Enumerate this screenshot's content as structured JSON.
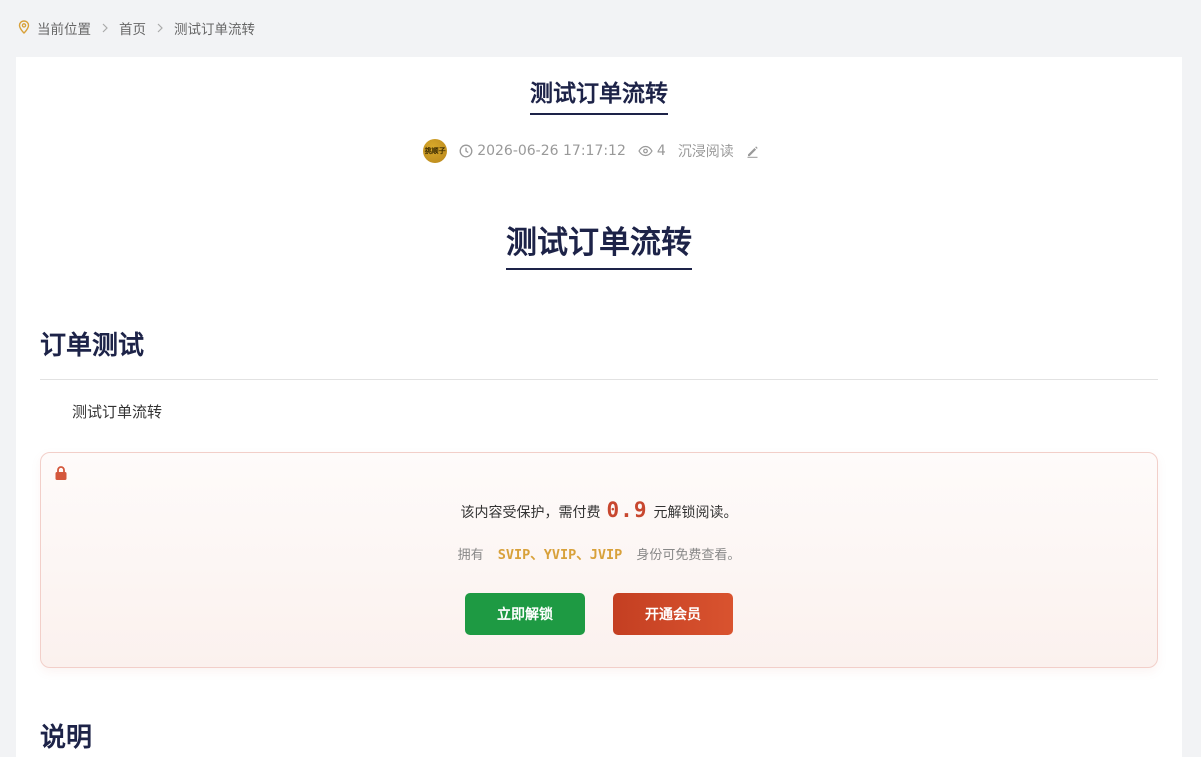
{
  "breadcrumb": {
    "location_label": "当前位置",
    "home": "首页",
    "current": "测试订单流转"
  },
  "post": {
    "title": "测试订单流转",
    "avatar_text": "挑顺子",
    "datetime": "2026-06-26 17:17:12",
    "views": "4",
    "immersive_read": "沉浸阅读"
  },
  "content": {
    "title": "测试订单流转",
    "section1_heading": "订单测试",
    "paragraph": "测试订单流转",
    "section2_heading": "说明"
  },
  "paywall": {
    "msg_prefix": "该内容受保护，需付费",
    "price": "0.9",
    "msg_suffix": "元解锁阅读。",
    "vip_prefix": "拥有",
    "vip_levels": "SVIP、YVIP、JVIP",
    "vip_suffix": "身份可免费查看。",
    "unlock_button": "立即解锁",
    "vip_button": "开通会员"
  },
  "colors": {
    "heading": "#1d2348",
    "unlock_button": "#1e9a43",
    "vip_button": "#d04a2a",
    "price": "#c8472f",
    "vip_text": "#d8a13a"
  }
}
